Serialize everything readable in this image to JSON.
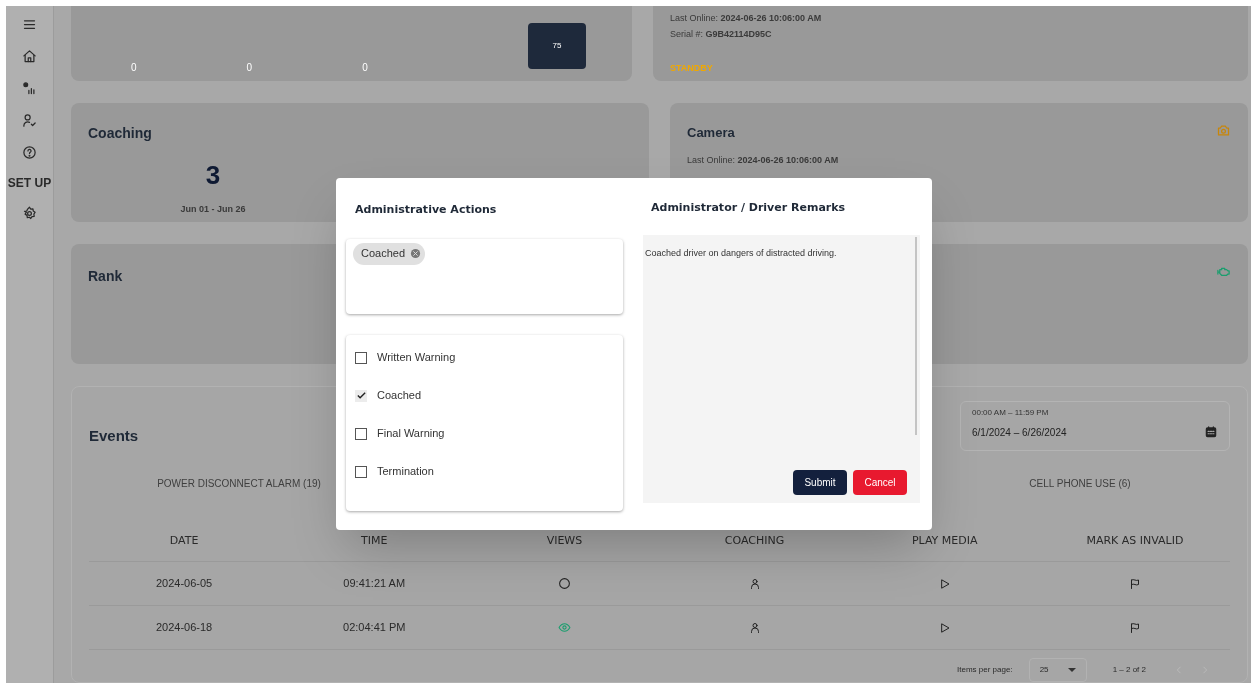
{
  "sidebar": {
    "items": [
      {
        "kind": "menu"
      },
      {
        "kind": "home"
      },
      {
        "kind": "stats"
      },
      {
        "kind": "user"
      },
      {
        "kind": "help"
      },
      {
        "kind": "label",
        "label": "SET UP"
      },
      {
        "kind": "settings"
      }
    ]
  },
  "score_card": {
    "axis_ticks": [
      "0",
      "0",
      "0"
    ],
    "value_label": "75"
  },
  "device_card": {
    "last_online_label": "Last Online:",
    "last_online": "2024-06-26 10:06:00 AM",
    "serial_label": "Serial #:",
    "serial": "G9B42114D95C",
    "status": "STANDBY"
  },
  "coaching_card": {
    "title": "Coaching",
    "count": "3",
    "range": "Jun 01 - Jun 26"
  },
  "camera_card": {
    "title": "Camera",
    "last_online_label": "Last Online:",
    "last_online": "2024-06-26 10:06:00 AM"
  },
  "rank_card": {
    "title": "Rank"
  },
  "events": {
    "title": "Events",
    "date_range": {
      "label": "00:00 AM – 11:59 PM",
      "value": "6/1/2024 – 6/26/2024"
    },
    "tabs": [
      {
        "label": "POWER DISCONNECT ALARM (19)",
        "selected": false
      },
      {
        "label": "CELL PHONE USE (6)",
        "selected": false
      }
    ],
    "table": {
      "columns": [
        "DATE",
        "TIME",
        "VIEWS",
        "COACHING",
        "PLAY MEDIA",
        "MARK AS INVALID"
      ],
      "rows": [
        {
          "date": "2024-06-05",
          "time": "09:41:21 AM",
          "viewed": false
        },
        {
          "date": "2024-06-18",
          "time": "02:04:41 PM",
          "viewed": true
        }
      ]
    },
    "pagination": {
      "items_per_page_label": "Items per page:",
      "items_per_page": "25",
      "range": "1 – 2 of 2"
    }
  },
  "dialog": {
    "actions_title": "Administrative Actions",
    "chips": [
      "Coached"
    ],
    "options": [
      {
        "label": "Written Warning",
        "checked": false
      },
      {
        "label": "Coached",
        "checked": true
      },
      {
        "label": "Final Warning",
        "checked": false
      },
      {
        "label": "Termination",
        "checked": false
      }
    ],
    "remarks_title": "Administrator / Driver Remarks",
    "remarks": "Coached driver on dangers of distracted driving.",
    "buttons": [
      {
        "label": "Submit",
        "kind": "primary"
      },
      {
        "label": "Cancel",
        "kind": "danger"
      }
    ]
  }
}
